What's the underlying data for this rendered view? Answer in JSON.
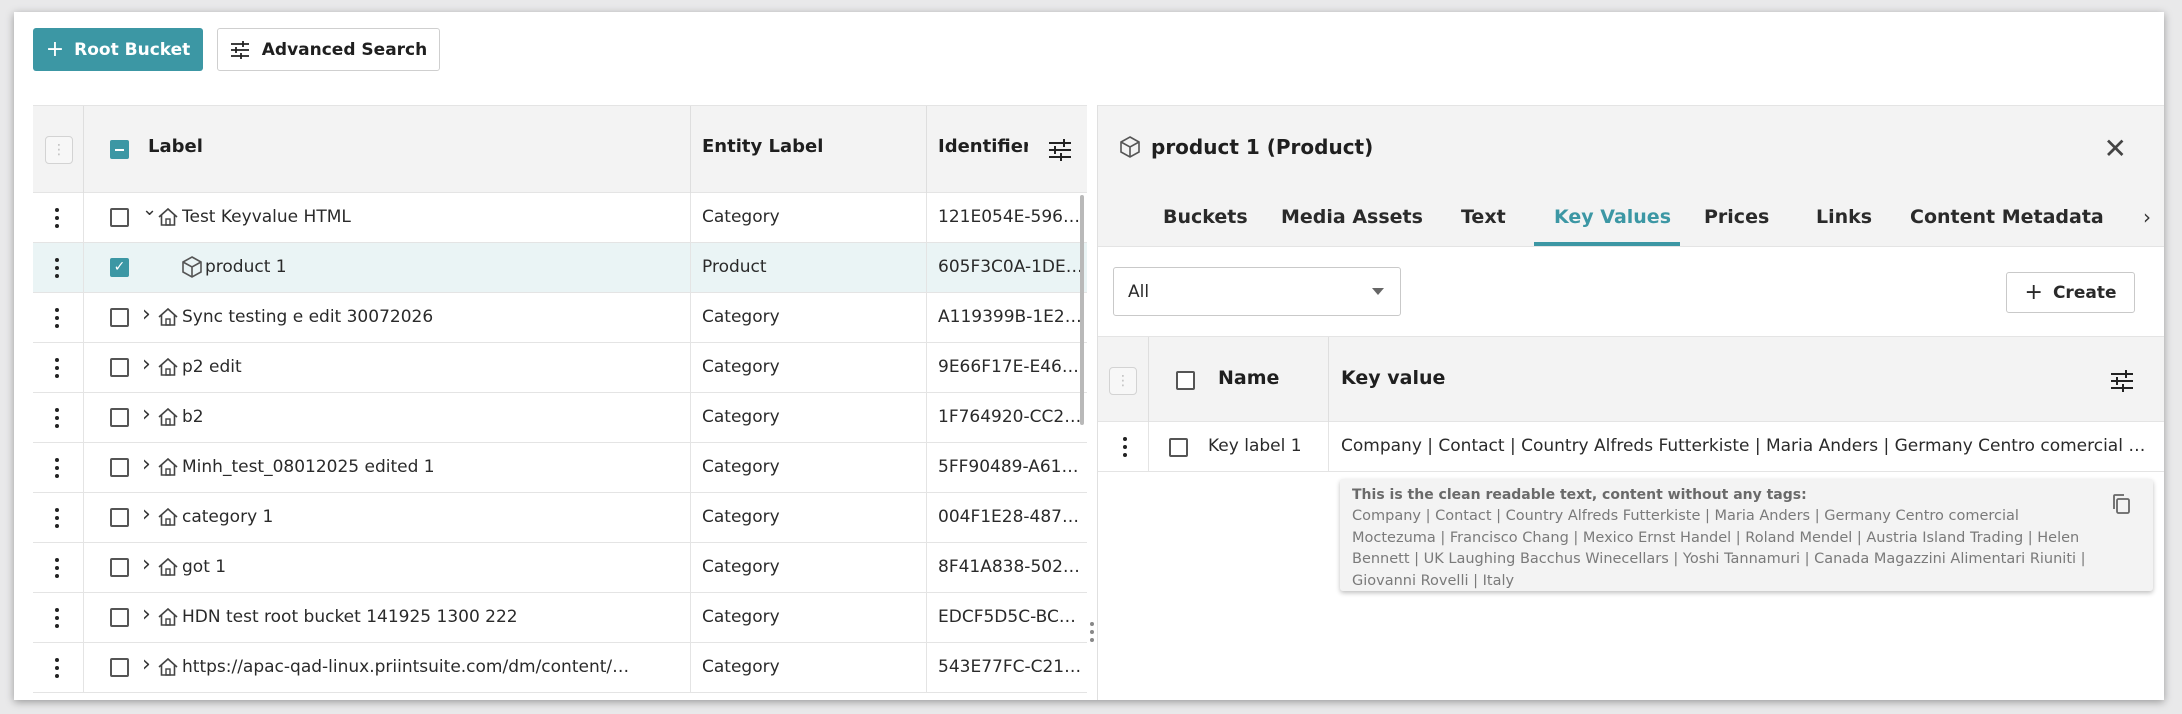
{
  "toolbar": {
    "root_bucket_label": "Root Bucket",
    "advanced_search_label": "Advanced Search"
  },
  "left_table": {
    "headers": {
      "label": "Label",
      "entity_label": "Entity Label",
      "identifier": "Identifier"
    },
    "rows": [
      {
        "label": "Test Keyvalue HTML",
        "entity": "Category",
        "id": "121E054E-5968-…",
        "expanded": true,
        "selected": false
      },
      {
        "label": "product 1",
        "entity": "Product",
        "id": "605F3C0A-1DED…",
        "expanded": false,
        "selected": true
      },
      {
        "label": "Sync testing e edit 30072026",
        "entity": "Category",
        "id": "A119399B-1E24-4…",
        "expanded": false,
        "selected": false
      },
      {
        "label": "p2 edit",
        "entity": "Category",
        "id": "9E66F17E-E463-…",
        "expanded": false,
        "selected": false
      },
      {
        "label": "b2",
        "entity": "Category",
        "id": "1F764920-CC2F-…",
        "expanded": false,
        "selected": false
      },
      {
        "label": "Minh_test_08012025 edited 1",
        "entity": "Category",
        "id": "5FF90489-A615-…",
        "expanded": false,
        "selected": false
      },
      {
        "label": "category 1",
        "entity": "Category",
        "id": "004F1E28-487A-…",
        "expanded": false,
        "selected": false
      },
      {
        "label": "got 1",
        "entity": "Category",
        "id": "8F41A838-502F-…",
        "expanded": false,
        "selected": false
      },
      {
        "label": "HDN test root bucket 141925 1300 222",
        "entity": "Category",
        "id": "EDCF5D5C-BC91…",
        "expanded": false,
        "selected": false
      },
      {
        "label": "https://apac-qad-linux.priintsuite.com/dm/content/…",
        "entity": "Category",
        "id": "543E77FC-C214-…",
        "expanded": false,
        "selected": false
      }
    ]
  },
  "detail": {
    "title": "product 1 (Product)",
    "tabs": [
      "Buckets",
      "Media Assets",
      "Text",
      "Key Values",
      "Prices",
      "Links",
      "Content Metadata"
    ],
    "active_tab": "Key Values",
    "filter_value": "All",
    "create_label": "Create",
    "kv_headers": {
      "name": "Name",
      "key_value": "Key value"
    },
    "kv_rows": [
      {
        "name": "Key label 1",
        "value": "Company | Contact | Country Alfreds Futterkiste | Maria Anders | Germany Centro comercial Mo…"
      }
    ],
    "tooltip": {
      "title": "This is the clean readable text, content without any tags:",
      "body": "Company | Contact | Country Alfreds Futterkiste | Maria Anders | Germany Centro comercial Moctezuma | Francisco Chang | Mexico Ernst Handel | Roland Mendel | Austria Island Trading | Helen Bennett | UK Laughing Bacchus Winecellars | Yoshi Tannamuri | Canada Magazzini Alimentari Riuniti | Giovanni Rovelli | Italy"
    }
  },
  "colors": {
    "accent": "#3c97a4",
    "header_bg": "#f3f3f3",
    "selected_row_bg": "#eaf4f5"
  }
}
